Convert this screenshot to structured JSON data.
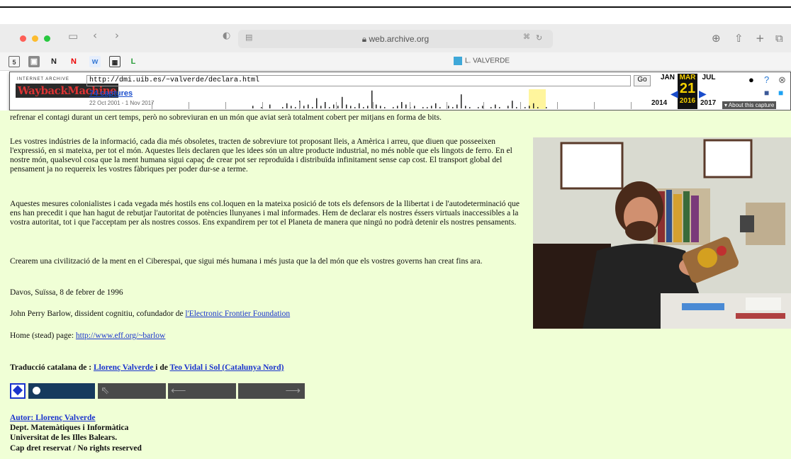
{
  "browser": {
    "url": "web.archive.org",
    "tab_title": "L. VALVERDE",
    "bookmarks": [
      "N",
      "N",
      "w",
      "L"
    ]
  },
  "wayback": {
    "archive_label": "INTERNET ARCHIVE",
    "logo_text": "WaybackMachine",
    "url_value": "http://dmi.uib.es/~valverde/declara.html",
    "go_label": "Go",
    "captures_link": "74 captures",
    "capture_range": "22 Oct 2001 - 1 Nov 2017",
    "months": {
      "prev": "JAN",
      "current": "MAR",
      "next": "JUL"
    },
    "day": "21",
    "years": {
      "prev": "2014",
      "current": "2016",
      "next": "2017"
    },
    "about_label": "▾ About this capture"
  },
  "content": {
    "cutoff_line": "refrenar el contagi durant un cert temps, però no sobreviuran en un món que aviat serà totalment cobert per mitjans en forma de bits.",
    "para1": "Les vostres indústries de la informació, cada dia més obsoletes, tracten de sobreviure tot proposant lleis, a Amèrica i arreu, que diuen que posseeixen l'expressió, en si mateixa, per tot el món. Aquestes lleis declaren que les idees són un altre producte industrial, no més noble que els lingots de ferro. En el nostre món, qualsevol cosa que la ment humana sigui capaç de crear pot ser reproduïda i distribuïda infinitament sense cap cost. El transport global del pensament ja no requereix les vostres fàbriques per poder dur-se a terme.",
    "para2": "Aquestes mesures colonialistes i cada vegada més hostils ens col.loquen en la mateixa posició de tots els defensors de la llibertat i de l'autodeterminació que ens han precedit i que han hagut de rebutjar l'autoritat de potències llunyanes i mal informades. Hem de declarar els nostres éssers virtuals inaccessibles a la vostra autoritat, tot i que l'acceptam per als nostres cossos. Ens expandirem per tot el Planeta de manera que ningú no podrà detenir els nostres pensaments.",
    "para3": "Crearem una civilització de la ment en el Ciberespai, que sigui més humana i més justa que la del món que els vostres governs han creat fins ara.",
    "place_date": "Davos, Suïssa, 8 de febrer de 1996",
    "signature_prefix": "John Perry Barlow, dissident cognitiu, cofundador de ",
    "eff_link": "l'Electronic Frontier Foundation",
    "home_prefix": "Home (stead) page: ",
    "home_link": "http://www.eff.org/~barlow",
    "translation_prefix": "Traducció catalana de : ",
    "translator1": "Llorenç Valverde ",
    "translation_and": " i de ",
    "translator2": "Teo Vidal i Sol (Catalunya Nord) ",
    "author_link": "Autor: Llorenç Valverde ",
    "dept": "Dept. Matemàtiques i Informàtica",
    "university": "Universitat de les Illes Balears.",
    "rights": "Cap dret reservat / No rights reserved"
  }
}
